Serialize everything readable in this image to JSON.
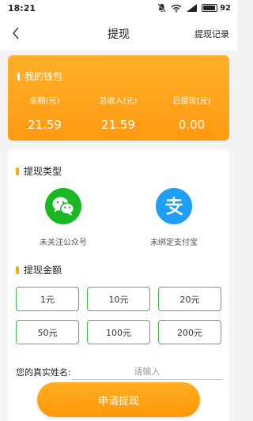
{
  "status_bar": {
    "time": "18:21",
    "battery_level": "92",
    "battery_fraction": 0.92
  },
  "nav": {
    "title": "提现",
    "record_label": "提现记录"
  },
  "wallet": {
    "title": "我的钱包",
    "stats": [
      {
        "label": "余额(元)",
        "value": "21.59"
      },
      {
        "label": "总收入(元)",
        "value": "21.59"
      },
      {
        "label": "已提现(元)",
        "value": "0.00"
      }
    ]
  },
  "withdraw_type": {
    "title": "提现类型",
    "options": [
      {
        "label": "未关注公众号",
        "icon": "wechat-icon",
        "color": "#17b821"
      },
      {
        "label": "未绑定支付宝",
        "icon": "alipay-icon",
        "color": "#1f9ef5"
      }
    ]
  },
  "withdraw_amount": {
    "title": "提现金额",
    "options": [
      "1元",
      "10元",
      "20元",
      "50元",
      "100元",
      "200元"
    ]
  },
  "real_name": {
    "label": "您的真实姓名:",
    "placeholder": "请输入",
    "value": ""
  },
  "submit_label": "申请提现",
  "colors": {
    "accent": "#ffa514",
    "amount_border": "#45b84a",
    "wechat": "#17b821",
    "alipay": "#1f9ef5"
  }
}
